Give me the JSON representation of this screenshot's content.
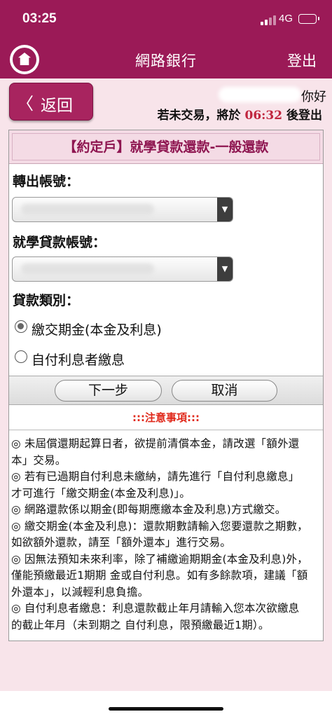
{
  "status": {
    "time": "03:25",
    "network": "4G"
  },
  "header": {
    "title": "網路銀行",
    "logout": "登出"
  },
  "session": {
    "back_label": "返回",
    "greeting_suffix": "你好",
    "prefix": "若未交易，將於",
    "countdown": "06:32",
    "suffix": "後登出"
  },
  "form": {
    "heading": "【約定戶】就學貸款還款-一般還款",
    "from_account_label": "轉出帳號：",
    "loan_account_label": "就學貸款帳號：",
    "loan_type_label": "貸款類別：",
    "options": [
      {
        "label": "繳交期金(本金及利息)",
        "selected": true
      },
      {
        "label": "自付利息者繳息",
        "selected": false
      }
    ],
    "next_button": "下一步",
    "cancel_button": "取消"
  },
  "notice": {
    "heading": ":::注意事項:::",
    "lines": [
      "◎ 未屆償還期起算日者，欲提前清償本金，請改選「額外還",
      "本」交易。",
      "◎ 若有已過期自付利息未繳納，請先進行「自付利息繳息」",
      "才可進行「繳交期金(本金及利息)」。",
      "◎ 網路還款係以期金(即每期應繳本金及利息)方式繳交。",
      "◎ 繳交期金(本金及利息)：還款期數請輸入您要還款之期數，",
      "如欲額外還款，請至「額外還本」進行交易。",
      "◎ 因無法預知未來利率，除了補繳逾期期金(本金及利息)外，",
      "僅能預繳最近1期期 金或自付利息。如有多餘款項，建議「額",
      "外還本」，以減輕利息負擔。",
      "◎ 自付利息者繳息：利息還款截止年月請輸入您本次欲繳息",
      "的截止年月（未到期之 自付利息，限預繳最近1期）。"
    ]
  }
}
